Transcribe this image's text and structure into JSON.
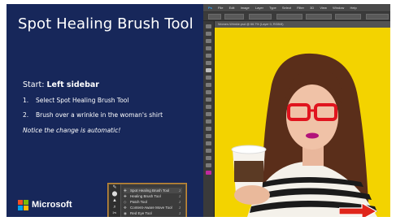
{
  "slide": {
    "title": "Spot Healing Brush Tool",
    "start_label": "Start:",
    "start_value": "Left sidebar",
    "steps": [
      {
        "num": "1.",
        "text": "Select Spot Healing Brush Tool"
      },
      {
        "num": "2.",
        "text": "Brush over a wrinkle in the woman's shirt"
      }
    ],
    "note": "Notice the change is automatic!",
    "brand": "Microsoft",
    "colors": {
      "background": "#17275a",
      "ms_red": "#f25022",
      "ms_green": "#7fba00",
      "ms_blue": "#00a4ef",
      "ms_yellow": "#ffb900"
    }
  },
  "tool_flyout": {
    "items": [
      {
        "icon": "spot-healing-icon",
        "label": "Spot Healing Brush Tool",
        "key": "J",
        "selected": true
      },
      {
        "icon": "healing-brush-icon",
        "label": "Healing Brush Tool",
        "key": "J",
        "selected": false
      },
      {
        "icon": "patch-icon",
        "label": "Patch Tool",
        "key": "J",
        "selected": false
      },
      {
        "icon": "content-aware-move-icon",
        "label": "Content-Aware Move Tool",
        "key": "J",
        "selected": false
      },
      {
        "icon": "red-eye-icon",
        "label": "Red Eye Tool",
        "key": "J",
        "selected": false
      }
    ]
  },
  "photoshop": {
    "menu": [
      "Ps",
      "File",
      "Edit",
      "Image",
      "Layer",
      "Type",
      "Select",
      "Filter",
      "3D",
      "View",
      "Window",
      "Help"
    ],
    "document_tab": "Women-Wrinkle.psd @ 66.7% (Layer 0, RGB/8)",
    "canvas_color": "#f2d200"
  },
  "navigation": {
    "next_icon": "red-arrow-icon",
    "arrow_color": "#e0261b"
  }
}
